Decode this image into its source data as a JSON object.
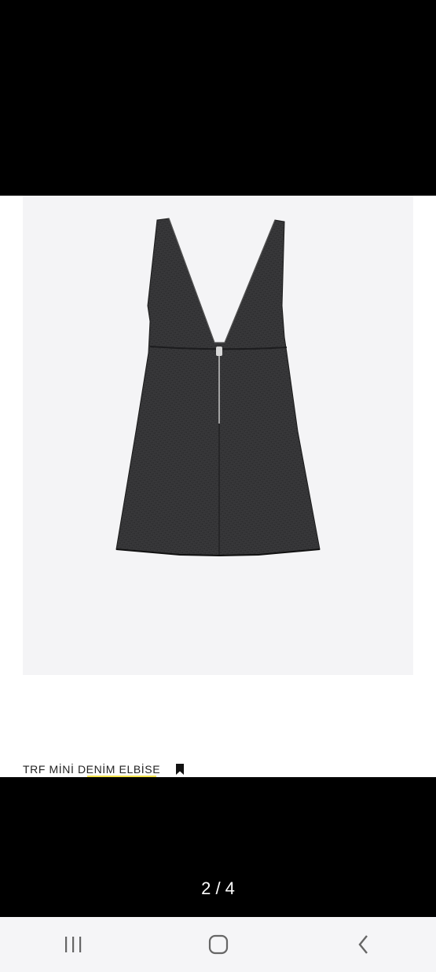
{
  "product": {
    "title": "TRF MİNİ DENİM ELBİSE",
    "image_icon": "dress-image",
    "bookmark_icon": "bookmark-icon"
  },
  "gallery": {
    "pager_text": "2 / 4"
  },
  "system_nav": {
    "recents_icon": "recents-icon",
    "home_icon": "home-icon",
    "back_icon": "back-icon"
  },
  "colors": {
    "background": "#000000",
    "image_bg": "#f4f4f6",
    "underline": "#f2e24a",
    "navbar_bg": "#f5f5f7",
    "icon": "#666666"
  }
}
